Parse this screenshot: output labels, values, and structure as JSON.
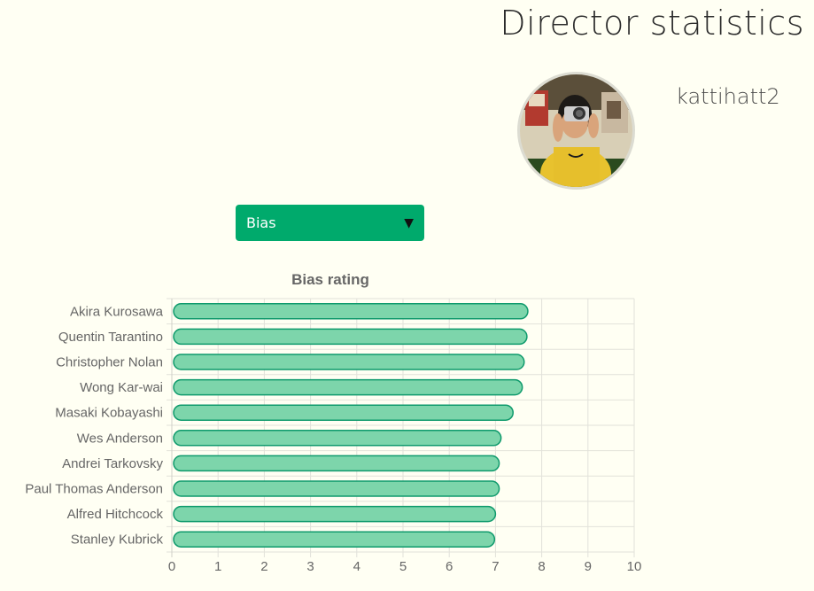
{
  "page": {
    "title": "Director statistics",
    "background": "#fffff3"
  },
  "user": {
    "name": "kattihatt2",
    "avatar_icon": "user-avatar-photo"
  },
  "selector": {
    "selected": "Bias",
    "color": "#00aa6c",
    "arrow_icon": "triangle-down-icon"
  },
  "chart_data": {
    "type": "bar",
    "orientation": "horizontal",
    "title": "Bias rating",
    "categories": [
      "Akira Kurosawa",
      "Quentin Tarantino",
      "Christopher Nolan",
      "Wong Kar-wai",
      "Masaki Kobayashi",
      "Wes Anderson",
      "Andrei Tarkovsky",
      "Paul Thomas Anderson",
      "Alfred Hitchcock",
      "Stanley Kubrick"
    ],
    "values": [
      7.7,
      7.68,
      7.62,
      7.58,
      7.38,
      7.12,
      7.08,
      7.08,
      7.0,
      6.98
    ],
    "xlim": [
      0,
      10
    ],
    "xticks": [
      0,
      1,
      2,
      3,
      4,
      5,
      6,
      7,
      8,
      9,
      10
    ],
    "grid": true,
    "bar_fill": "#7dd5ab",
    "bar_stroke": "#0f9a6c"
  }
}
